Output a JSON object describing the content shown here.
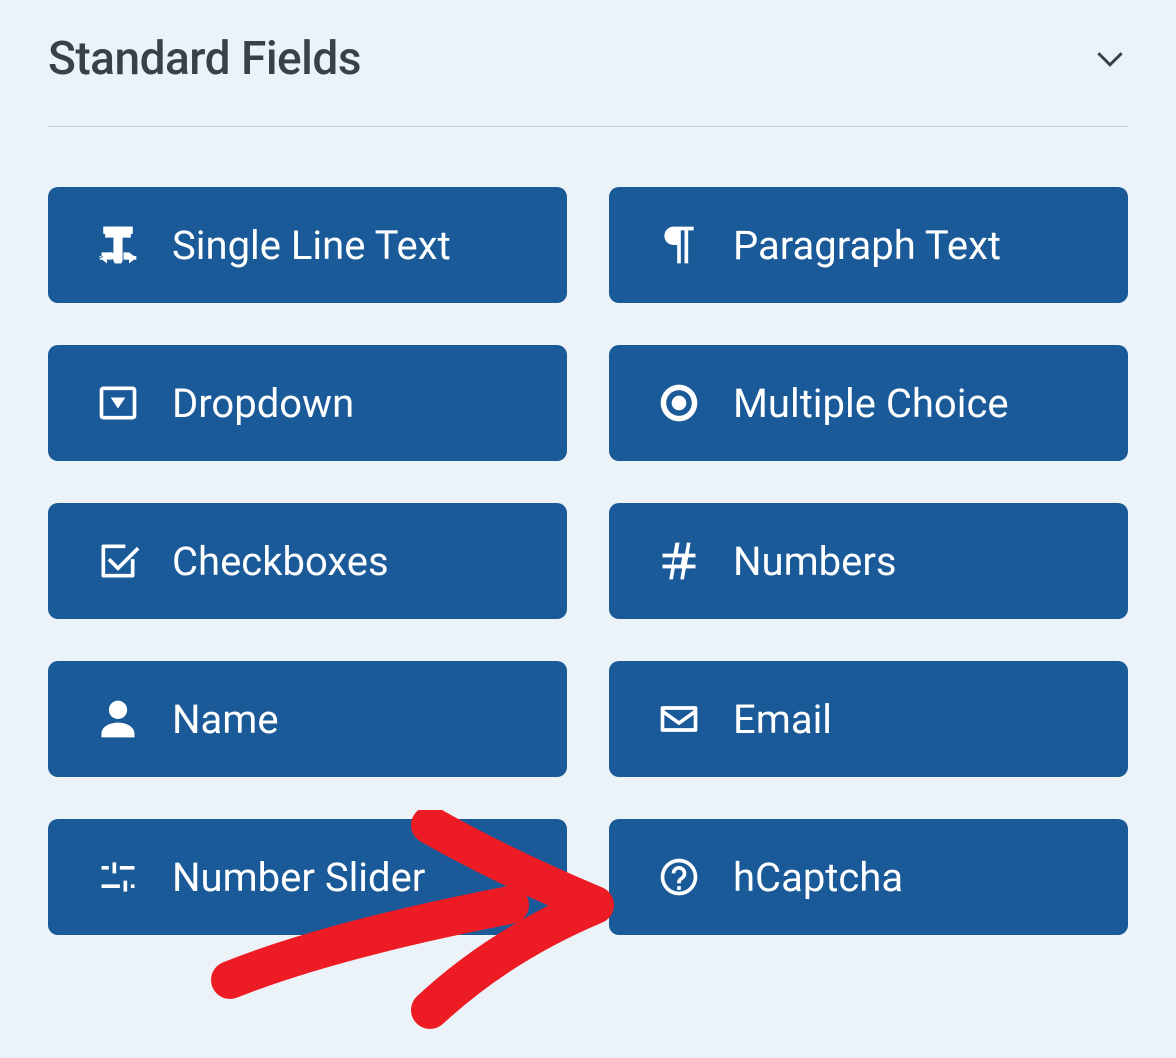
{
  "section": {
    "title": "Standard Fields"
  },
  "fields": [
    {
      "label": "Single Line Text",
      "icon": "text-cursor-icon"
    },
    {
      "label": "Paragraph Text",
      "icon": "paragraph-icon"
    },
    {
      "label": "Dropdown",
      "icon": "dropdown-icon"
    },
    {
      "label": "Multiple Choice",
      "icon": "radio-icon"
    },
    {
      "label": "Checkboxes",
      "icon": "checkbox-icon"
    },
    {
      "label": "Numbers",
      "icon": "hash-icon"
    },
    {
      "label": "Name",
      "icon": "person-icon"
    },
    {
      "label": "Email",
      "icon": "envelope-icon"
    },
    {
      "label": "Number Slider",
      "icon": "slider-icon"
    },
    {
      "label": "hCaptcha",
      "icon": "question-icon"
    }
  ],
  "colors": {
    "buttonBg": "#1a5a99",
    "pageBg": "#ecf3f8",
    "textDark": "#38404a",
    "annotation": "#ed1c24"
  }
}
